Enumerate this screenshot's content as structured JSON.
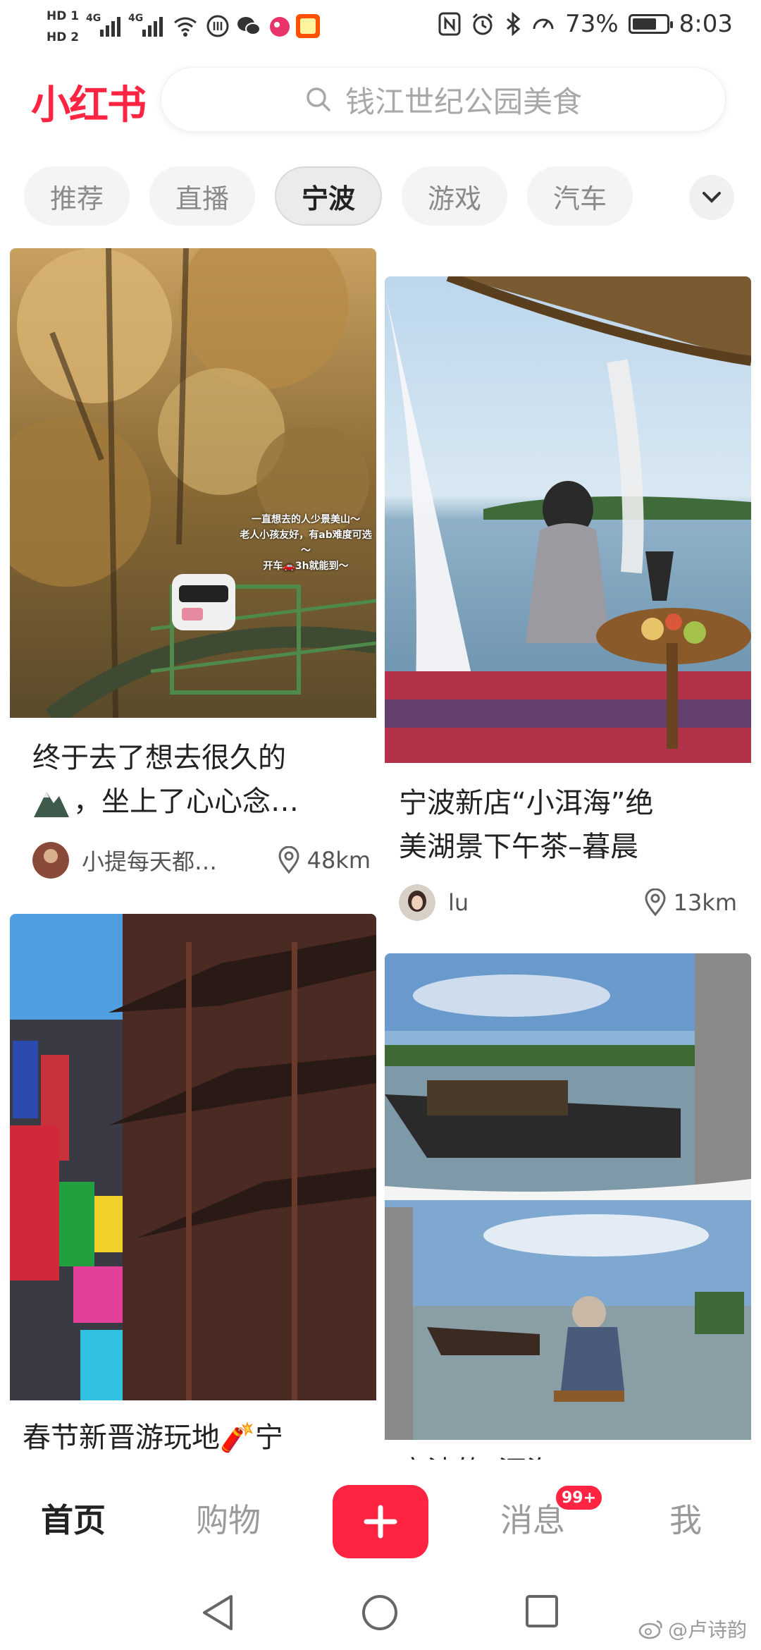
{
  "status_bar": {
    "hd1": "HD 1",
    "hd2": "HD 2",
    "net1": "4G",
    "net2": "4G",
    "battery": "73%",
    "battery_level": 0.73,
    "time": "8:03"
  },
  "header": {
    "logo": "小红书",
    "search_placeholder": "钱江世纪公园美食"
  },
  "tabs": [
    "推荐",
    "直播",
    "宁波",
    "游戏",
    "汽车"
  ],
  "active_tab": "宁波",
  "feed": [
    {
      "title": "终于去了想去很久的",
      "title_line2": "，坐上了心心念…",
      "author": "小提每天都…",
      "distance": "48km",
      "image_caption_lines": [
        "一直想去的人少景美山～",
        "老人小孩友好，有ab难度可选～",
        "开车🚗3h就能到～"
      ]
    },
    {
      "title": "宁波新店“小洱海”绝",
      "title_line2": "美湖景下午茶–暮晨",
      "author": "lu",
      "distance": "13km"
    },
    {
      "title": "春节新晋游玩地🧨宁"
    },
    {
      "title": "宁波的“洱海”"
    }
  ],
  "bottom_nav": {
    "home": "首页",
    "shop": "购物",
    "plus": "+",
    "messages": "消息",
    "messages_badge": "99+",
    "me": "我"
  },
  "watermark": "@卢诗韵",
  "colors": {
    "brand": "#ff2442"
  }
}
